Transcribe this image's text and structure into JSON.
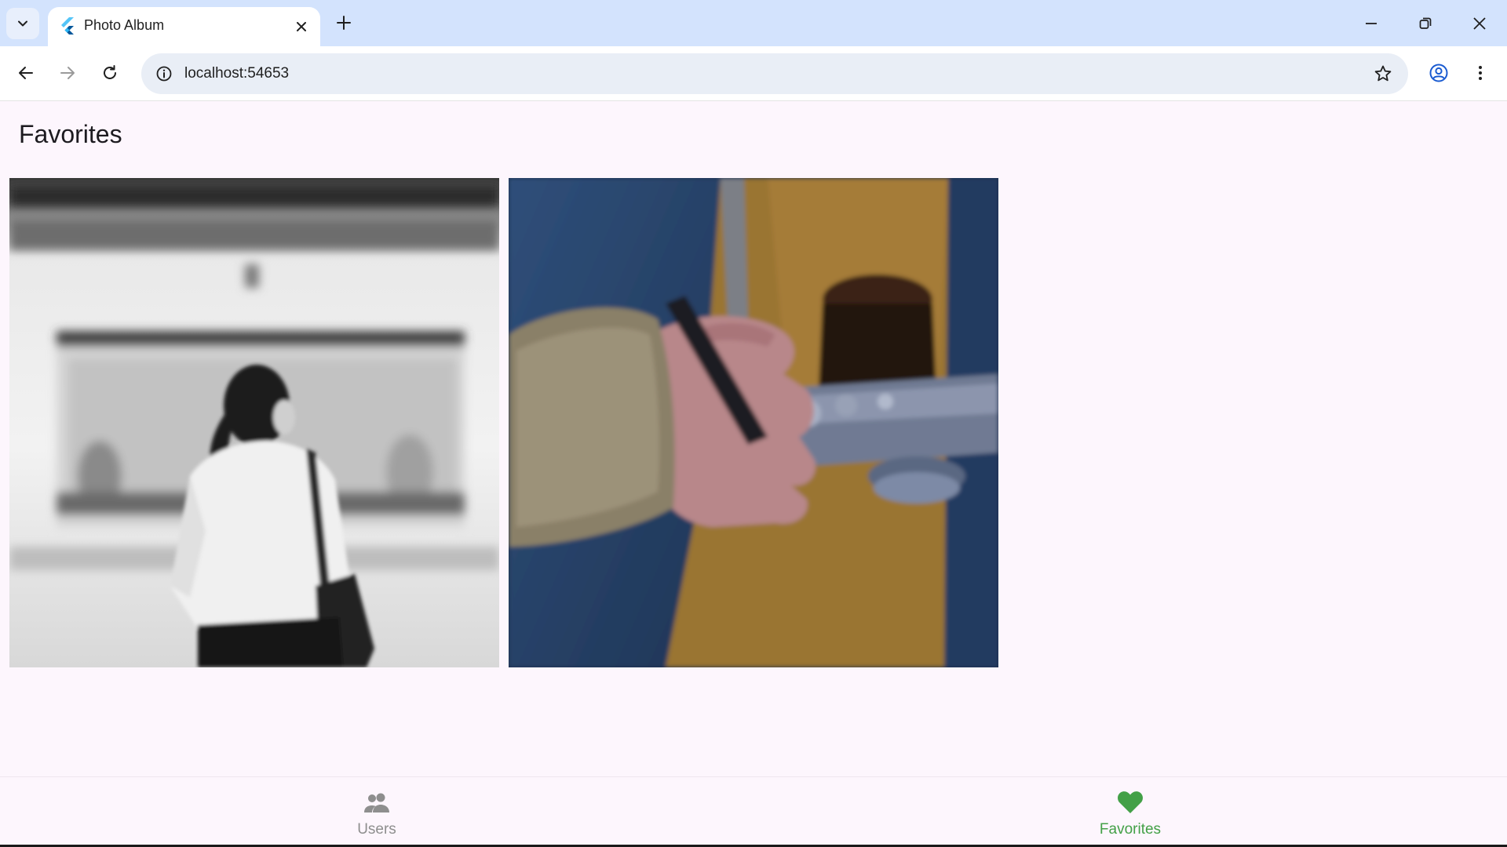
{
  "browser": {
    "tab_title": "Photo Album",
    "url": "localhost:54653",
    "icons": {
      "tab_search": "chevron-down-icon",
      "favicon": "flutter-icon",
      "tab_close": "close-icon",
      "new_tab": "plus-icon",
      "minimize": "minimize-icon",
      "restore": "restore-icon",
      "close_window": "close-icon",
      "back": "arrow-left-icon",
      "forward": "arrow-right-icon",
      "reload": "reload-icon",
      "site_info": "info-icon",
      "bookmark": "star-icon",
      "profile": "account-circle-icon",
      "menu": "more-vert-icon"
    }
  },
  "page": {
    "title": "Favorites",
    "photos": [
      {
        "subject": "woman-in-front-of-moving-train"
      },
      {
        "subject": "hand-holding-camera"
      }
    ]
  },
  "bottom_nav": {
    "items": [
      {
        "label": "Users",
        "icon": "people-icon",
        "selected": false
      },
      {
        "label": "Favorites",
        "icon": "heart-icon",
        "selected": true
      }
    ],
    "colors": {
      "selected": "#43a047",
      "unselected": "#8e8e8e"
    }
  },
  "colors": {
    "tabstrip": "#d3e3fd",
    "page_background": "#fdf6fd",
    "omnibox": "#e9eef6"
  }
}
